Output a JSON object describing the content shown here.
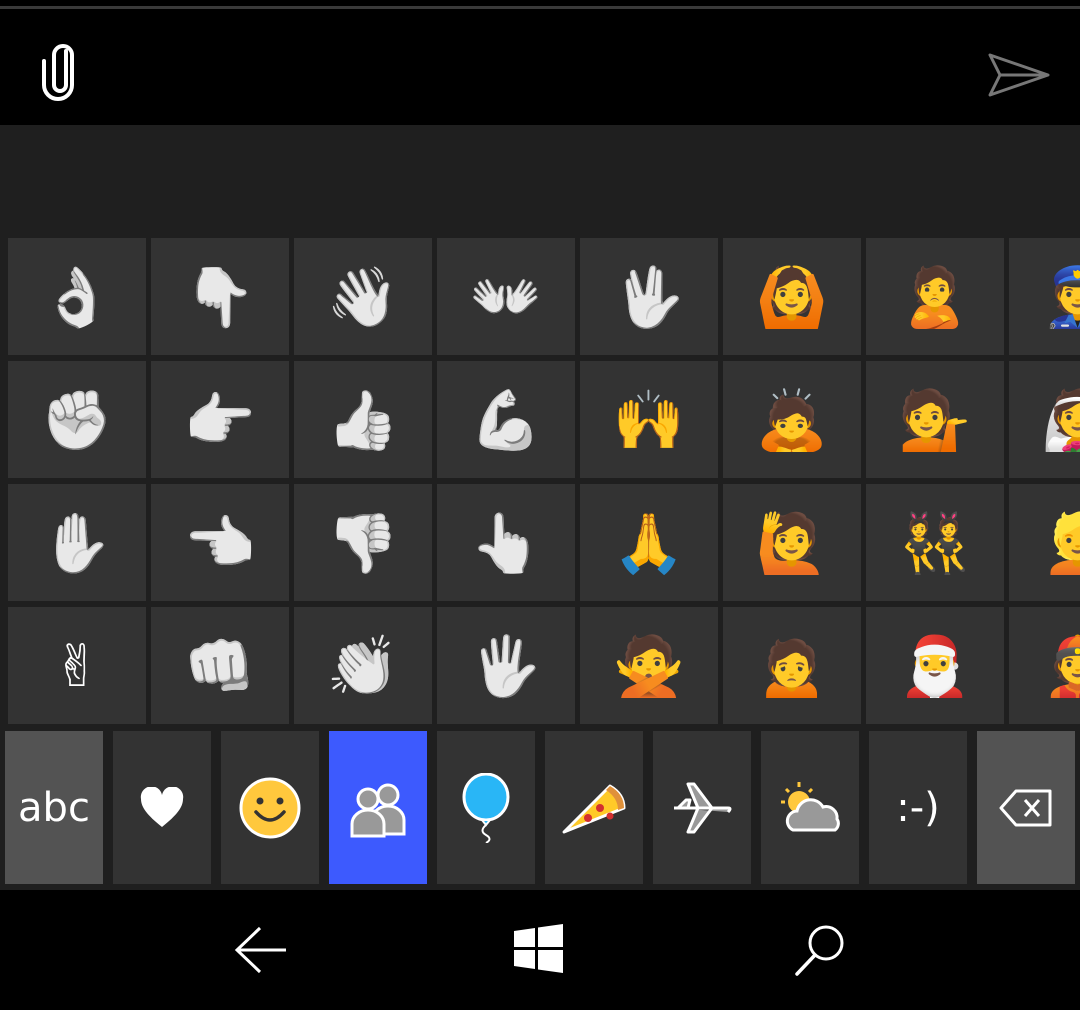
{
  "compose": {
    "attach_icon": "paperclip-icon",
    "send_icon": "send-arrow-icon"
  },
  "emoji_grid": [
    {
      "glyph": "👌",
      "name": "ok-hand",
      "gray": true
    },
    {
      "glyph": "👇",
      "name": "pointing-down",
      "gray": true
    },
    {
      "glyph": "👋",
      "name": "waving-hand",
      "gray": true
    },
    {
      "glyph": "👐",
      "name": "open-hands",
      "gray": true
    },
    {
      "glyph": "🖖",
      "name": "vulcan-salute",
      "gray": true
    },
    {
      "glyph": "🙆",
      "name": "person-gesturing-ok",
      "gray": false
    },
    {
      "glyph": "🙎",
      "name": "person-pouting",
      "gray": false
    },
    {
      "glyph": "👮",
      "name": "police-officer",
      "gray": false
    },
    {
      "glyph": "✊",
      "name": "raised-fist",
      "gray": true
    },
    {
      "glyph": "👉",
      "name": "pointing-right",
      "gray": true
    },
    {
      "glyph": "👍",
      "name": "thumbs-up",
      "gray": true
    },
    {
      "glyph": "💪",
      "name": "flexed-biceps",
      "gray": true
    },
    {
      "glyph": "🙌",
      "name": "raising-hands-person",
      "gray": false
    },
    {
      "glyph": "🙇",
      "name": "person-bowing",
      "gray": false
    },
    {
      "glyph": "💁",
      "name": "person-tipping-hand",
      "gray": false
    },
    {
      "glyph": "👰",
      "name": "person-with-veil",
      "gray": false
    },
    {
      "glyph": "✋",
      "name": "raised-hand",
      "gray": true
    },
    {
      "glyph": "👈",
      "name": "pointing-left",
      "gray": true
    },
    {
      "glyph": "👎",
      "name": "thumbs-down",
      "gray": true
    },
    {
      "glyph": "👆",
      "name": "pointing-up",
      "gray": true
    },
    {
      "glyph": "🙏",
      "name": "folded-hands-person",
      "gray": false
    },
    {
      "glyph": "🙋",
      "name": "person-raising-hand",
      "gray": false
    },
    {
      "glyph": "👯",
      "name": "bunny-ears-person",
      "gray": false
    },
    {
      "glyph": "👱",
      "name": "blond-person",
      "gray": false
    },
    {
      "glyph": "✌",
      "name": "victory-hand",
      "gray": true
    },
    {
      "glyph": "👊",
      "name": "oncoming-fist",
      "gray": true
    },
    {
      "glyph": "👏",
      "name": "clapping-hands",
      "gray": true
    },
    {
      "glyph": "🖐",
      "name": "hand-splayed",
      "gray": true
    },
    {
      "glyph": "🙅",
      "name": "person-gesturing-no",
      "gray": false
    },
    {
      "glyph": "🙍",
      "name": "person-frowning",
      "gray": false
    },
    {
      "glyph": "🎅",
      "name": "santa-claus",
      "gray": false
    },
    {
      "glyph": "👲",
      "name": "person-with-cap",
      "gray": false
    }
  ],
  "categories": [
    {
      "name": "abc",
      "label": "abc"
    },
    {
      "name": "heart",
      "icon": "heart-icon"
    },
    {
      "name": "smiley",
      "icon": "smiley-icon"
    },
    {
      "name": "people",
      "icon": "people-icon",
      "active": true
    },
    {
      "name": "balloon",
      "icon": "balloon-icon"
    },
    {
      "name": "pizza",
      "icon": "pizza-icon"
    },
    {
      "name": "airplane",
      "icon": "airplane-icon"
    },
    {
      "name": "weather",
      "icon": "sun-cloud-icon"
    },
    {
      "name": "emoticon",
      "label": ":-)"
    },
    {
      "name": "backspace",
      "icon": "backspace-icon"
    }
  ],
  "colors": {
    "accent": "#3d5afe",
    "key": "#333333",
    "key_special": "#535353",
    "panel": "#1f1f1f"
  },
  "nav": {
    "back_icon": "back-arrow-icon",
    "home_icon": "windows-logo-icon",
    "search_icon": "search-icon"
  }
}
